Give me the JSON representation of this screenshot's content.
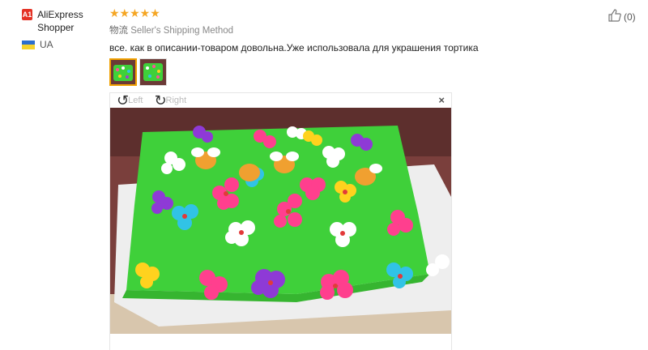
{
  "reviewer": {
    "badge": "A1",
    "name": "AliExpress Shopper",
    "country": "UA"
  },
  "review": {
    "rating_text": "★★★★★",
    "rating_value": 5,
    "shipping_cn": "物流",
    "shipping": "Seller's Shipping Method",
    "text": "все. как в описании-товаром довольна.Уже использовала для украшения тортика"
  },
  "viewer": {
    "rotate_left": "Left",
    "rotate_right": "Right",
    "close": "×"
  },
  "like": {
    "count": "(0)"
  },
  "colors": {
    "star": "#f5a623",
    "badge": "#e43225",
    "active_thumb": "#f0a000",
    "cake_green": "#3fd03a"
  }
}
